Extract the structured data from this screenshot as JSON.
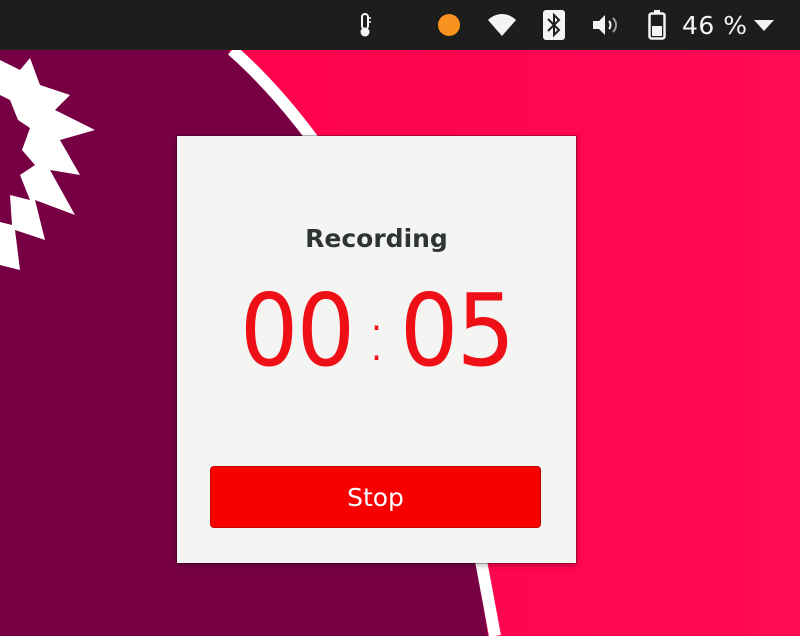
{
  "top_bar": {
    "icons": [
      "thermometer-icon",
      "status-dot-icon",
      "wifi-icon",
      "bluetooth-icon",
      "volume-icon",
      "battery-icon",
      "dropdown-arrow-icon"
    ],
    "battery_percent": "46 %",
    "status_dot_color": "#f7931e"
  },
  "dialog": {
    "title": "Recording",
    "timer_minutes": "00",
    "timer_separator": ":",
    "timer_seconds": "05",
    "stop_label": "Stop",
    "timer_color": "#ef0f16",
    "stop_color": "#f80000"
  },
  "wallpaper": {
    "left_color": "#770044",
    "right_color": "#ff0a50"
  }
}
